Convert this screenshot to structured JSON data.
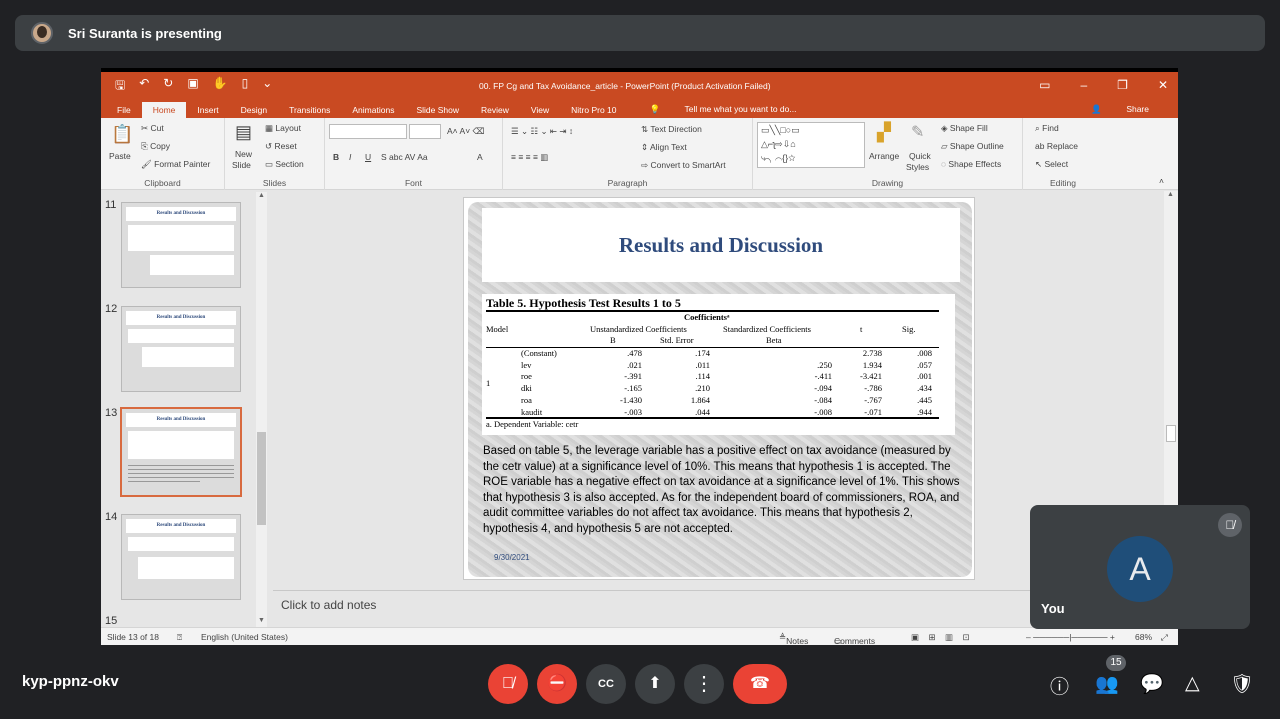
{
  "presenter": {
    "text": "Sri Suranta is presenting"
  },
  "window": {
    "title": "00. FP Cg and Tax Avoidance_article - PowerPoint (Product Activation Failed)"
  },
  "tabs": [
    "File",
    "Home",
    "Insert",
    "Design",
    "Transitions",
    "Animations",
    "Slide Show",
    "Review",
    "View",
    "Nitro Pro 10"
  ],
  "tell_me": "Tell me what you want to do...",
  "share": "Share",
  "ribbon": {
    "clipboard": {
      "paste": "Paste",
      "cut": "Cut",
      "copy": "Copy",
      "format_painter": "Format Painter",
      "label": "Clipboard"
    },
    "slides": {
      "new_slide_1": "New",
      "new_slide_2": "Slide",
      "layout": "Layout",
      "reset": "Reset",
      "section": "Section",
      "label": "Slides"
    },
    "font": {
      "label": "Font"
    },
    "paragraph": {
      "text_direction": "Text Direction",
      "align_text": "Align Text",
      "smartart": "Convert to SmartArt",
      "label": "Paragraph"
    },
    "drawing": {
      "arrange": "Arrange",
      "quick_styles_1": "Quick",
      "quick_styles_2": "Styles",
      "shape_fill": "Shape Fill",
      "shape_outline": "Shape Outline",
      "shape_effects": "Shape Effects",
      "label": "Drawing"
    },
    "editing": {
      "find": "Find",
      "replace": "Replace",
      "select": "Select",
      "label": "Editing"
    }
  },
  "thumbnails": [
    {
      "num": "11",
      "title": "Results and Discussion"
    },
    {
      "num": "12",
      "title": "Results and Discussion"
    },
    {
      "num": "13",
      "title": "Results and Discussion"
    },
    {
      "num": "14",
      "title": "Results and Discussion"
    },
    {
      "num": "15"
    }
  ],
  "slide": {
    "title": "Results and Discussion",
    "table_title": "Table 5. Hypothesis Test Results 1 to 5",
    "coeff_header": "Coefficientsᵃ",
    "headers": {
      "model": "Model",
      "unstd": "Unstandardized Coefficients",
      "std": "Standardized Coefficients",
      "t": "t",
      "sig": "Sig.",
      "b": "B",
      "se": "Std. Error",
      "beta": "Beta"
    },
    "model_num": "1",
    "rows": [
      {
        "name": "(Constant)",
        "b": ".478",
        "se": ".174",
        "beta": "",
        "t": "2.738",
        "sig": ".008"
      },
      {
        "name": "lev",
        "b": ".021",
        "se": ".011",
        "beta": ".250",
        "t": "1.934",
        "sig": ".057"
      },
      {
        "name": "roe",
        "b": "-.391",
        "se": ".114",
        "beta": "-.411",
        "t": "-3.421",
        "sig": ".001"
      },
      {
        "name": "dki",
        "b": "-.165",
        "se": ".210",
        "beta": "-.094",
        "t": "-.786",
        "sig": ".434"
      },
      {
        "name": "roa",
        "b": "-1.430",
        "se": "1.864",
        "beta": "-.084",
        "t": "-.767",
        "sig": ".445"
      },
      {
        "name": "kaudit",
        "b": "-.003",
        "se": ".044",
        "beta": "-.008",
        "t": "-.071",
        "sig": ".944"
      }
    ],
    "footnote": "a. Dependent Variable: cetr",
    "body": "Based on table 5, the leverage variable has a positive effect on tax avoidance (measured by the cetr value) at a significance level of 10%. This means that hypothesis 1 is accepted. The ROE variable has a negative effect on tax avoidance at a significance level of 1%. This shows that hypothesis 3 is also accepted. As for the independent board of commissioners, ROA, and audit committee variables do not affect tax avoidance. This means that hypothesis 2, hypothesis 4, and hypothesis 5 are not accepted.",
    "date": "9/30/2021"
  },
  "notes_placeholder": "Click to add notes",
  "status": {
    "slide": "Slide 13 of 18",
    "language": "English (United States)",
    "notes": "Notes",
    "comments": "Comments",
    "zoom": "68%"
  },
  "you_tile": {
    "initial": "A",
    "name": "You"
  },
  "meeting": {
    "code": "kyp-ppnz-okv",
    "participants": "15"
  }
}
